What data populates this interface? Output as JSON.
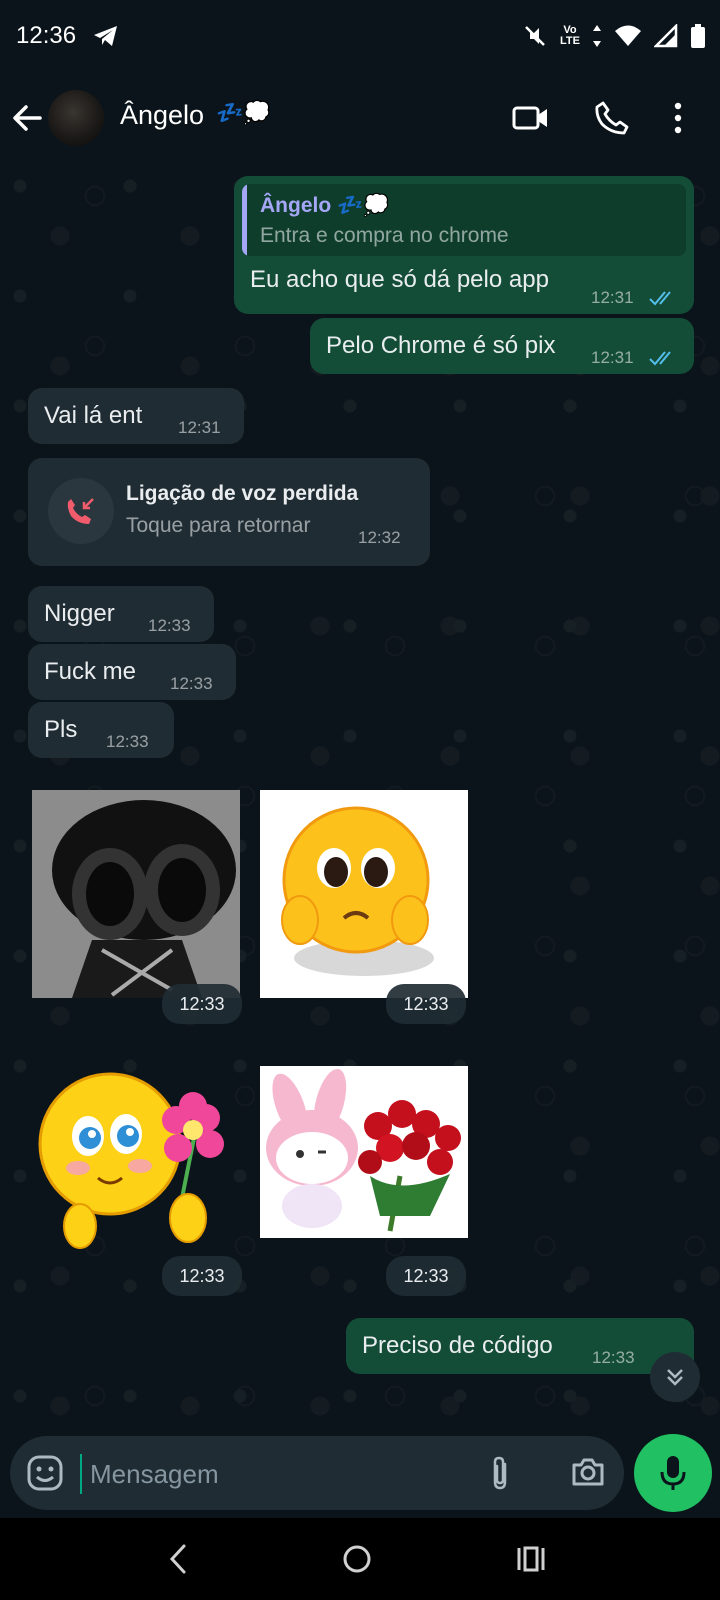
{
  "status_bar": {
    "time": "12:36",
    "volte_top": "Vo",
    "volte_bottom": "LTE",
    "icons": [
      "telegram-icon",
      "mute-icon",
      "data-arrows-icon",
      "wifi-icon",
      "signal-icon",
      "battery-icon"
    ]
  },
  "header": {
    "contact_name": "Ângelo",
    "contact_emoji": "💤💭",
    "icons": [
      "back-arrow-icon",
      "video-call-icon",
      "phone-call-icon",
      "more-options-icon"
    ]
  },
  "messages": [
    {
      "direction": "out",
      "quote": {
        "name": "Ângelo 💤💭",
        "text": "Entra e compra no chrome"
      },
      "text": "Eu acho que só dá pelo app",
      "time": "12:31",
      "read": true
    },
    {
      "direction": "out",
      "text": "Pelo Chrome é só pix",
      "time": "12:31",
      "read": true
    },
    {
      "direction": "in",
      "text": "Vai lá ent",
      "time": "12:31"
    },
    {
      "direction": "in",
      "type": "missed_call",
      "title": "Ligação de voz perdida",
      "subtitle": "Toque para retornar",
      "time": "12:32"
    },
    {
      "direction": "in",
      "text": "Nigger",
      "time": "12:33"
    },
    {
      "direction": "in",
      "text": "Fuck me",
      "time": "12:33"
    },
    {
      "direction": "in",
      "text": "Pls",
      "time": "12:33"
    },
    {
      "direction": "in",
      "type": "sticker",
      "sticker": "dark-cartoon-character-sticker",
      "time": "12:33"
    },
    {
      "direction": "in",
      "type": "sticker",
      "sticker": "pleading-face-emoji-sticker",
      "time": "12:33"
    },
    {
      "direction": "in",
      "type": "sticker",
      "sticker": "smiley-holding-flower-sticker",
      "time": "12:33"
    },
    {
      "direction": "in",
      "type": "sticker",
      "sticker": "my-melody-with-roses-sticker",
      "time": "12:33"
    },
    {
      "direction": "out",
      "text": "Preciso de código",
      "time": "12:33",
      "read": false
    }
  ],
  "composer": {
    "placeholder": "Mensagem",
    "icons": [
      "emoji-icon",
      "attach-icon",
      "camera-icon",
      "mic-icon"
    ]
  },
  "colors": {
    "background": "#0b141a",
    "outgoing_bubble": "#144d37",
    "incoming_bubble": "#202c33",
    "accent_green": "#21c063",
    "read_ticks": "#53bdeb",
    "quote_name": "#a5a6f6",
    "missed_call_red": "#f15c6d"
  }
}
